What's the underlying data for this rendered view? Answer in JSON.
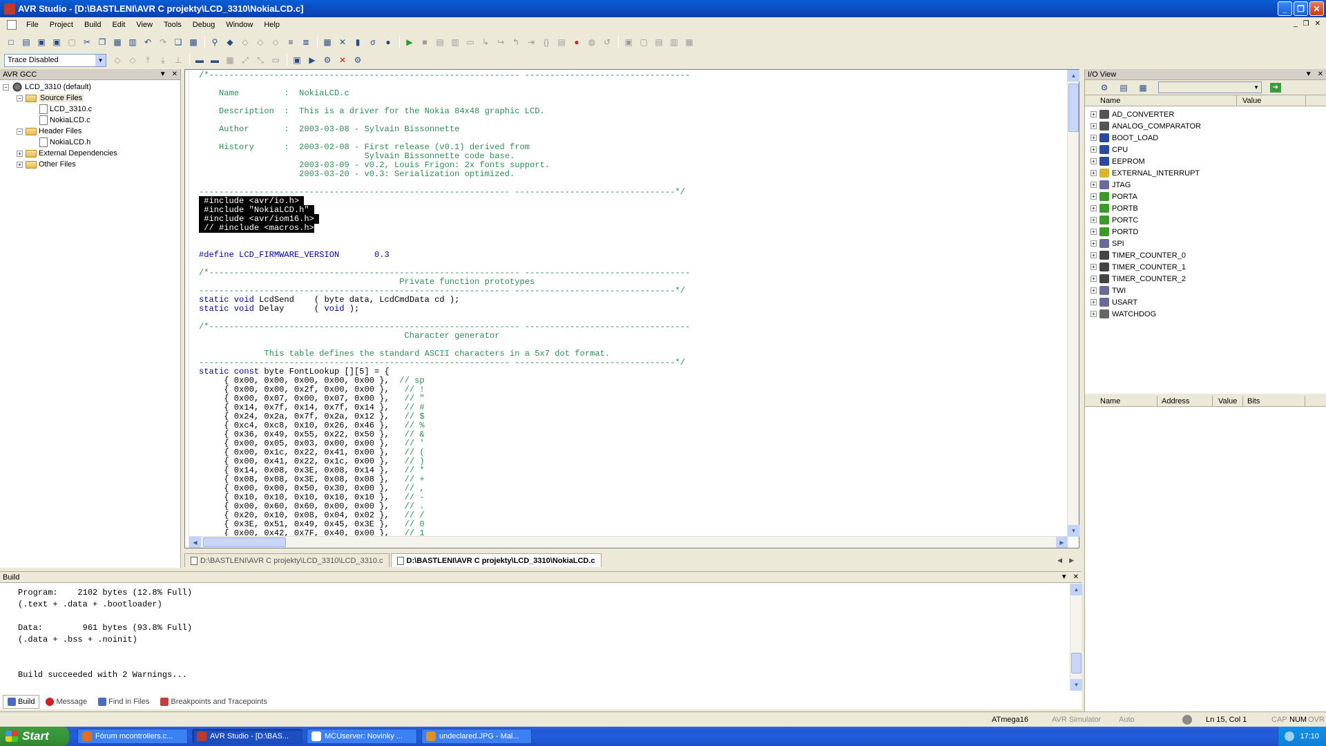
{
  "window": {
    "title": "AVR Studio - [D:\\BASTLENI\\AVR C projekty\\LCD_3310\\NokiaLCD.c]",
    "min": "_",
    "max": "❐",
    "close": "✕"
  },
  "menu": {
    "items": [
      "File",
      "Project",
      "Build",
      "Edit",
      "View",
      "Tools",
      "Debug",
      "Window",
      "Help"
    ],
    "mdi": [
      "_",
      "❐",
      "✕"
    ]
  },
  "toolbar2": {
    "trace_select": "Trace Disabled"
  },
  "left_panel": {
    "title": "AVR GCC",
    "tree": [
      {
        "label": "LCD_3310 (default)",
        "level": 0,
        "exp": "−",
        "icon": "proj"
      },
      {
        "label": "Source Files",
        "level": 1,
        "exp": "−",
        "icon": "folder"
      },
      {
        "label": "LCD_3310.c",
        "level": 2,
        "exp": "",
        "icon": "file"
      },
      {
        "label": "NokiaLCD.c",
        "level": 2,
        "exp": "",
        "icon": "file"
      },
      {
        "label": "Header Files",
        "level": 1,
        "exp": "−",
        "icon": "folder"
      },
      {
        "label": "NokiaLCD.h",
        "level": 2,
        "exp": "",
        "icon": "file"
      },
      {
        "label": "External Dependencies",
        "level": 1,
        "exp": "+",
        "icon": "folder"
      },
      {
        "label": "Other Files",
        "level": 1,
        "exp": "+",
        "icon": "folder"
      }
    ]
  },
  "editor": {
    "lines": [
      {
        "t": "c",
        "s": "/*-------------------------------------------------------------- ---------------------------------"
      },
      {
        "t": "c",
        "s": ""
      },
      {
        "t": "c",
        "s": "    Name         :  NokiaLCD.c"
      },
      {
        "t": "c",
        "s": ""
      },
      {
        "t": "c",
        "s": "    Description  :  This is a driver for the Nokia 84x48 graphic LCD."
      },
      {
        "t": "c",
        "s": ""
      },
      {
        "t": "c",
        "s": "    Author       :  2003-03-08 - Sylvain Bissonnette"
      },
      {
        "t": "c",
        "s": ""
      },
      {
        "t": "c",
        "s": "    History      :  2003-02-08 - First release (v0.1) derived from"
      },
      {
        "t": "c",
        "s": "                                 Sylvain Bissonnette code base."
      },
      {
        "t": "c",
        "s": "                    2003-03-09 - v0.2, Louis Frigon: 2x fonts support."
      },
      {
        "t": "c",
        "s": "                    2003-03-20 - v0.3: Serialization optimized."
      },
      {
        "t": "c",
        "s": ""
      },
      {
        "t": "c",
        "s": "-------------------------------------------------------------- --------------------------------*/"
      },
      {
        "t": "sel",
        "s": " #include <avr/io.h> "
      },
      {
        "t": "sel",
        "s": " #include \"NokiaLCD.h\" "
      },
      {
        "t": "sel",
        "s": " #include <avr/iom16.h> "
      },
      {
        "t": "sel",
        "s": " // #include <macros.h>"
      },
      {
        "t": "p",
        "s": ""
      },
      {
        "t": "p",
        "s": ""
      },
      {
        "t": "def",
        "s": "#define LCD_FIRMWARE_VERSION       0.3"
      },
      {
        "t": "p",
        "s": ""
      },
      {
        "t": "c",
        "s": "/*-------------------------------------------------------------- ---------------------------------"
      },
      {
        "t": "c",
        "s": "                                        Private function prototypes"
      },
      {
        "t": "c",
        "s": "-------------------------------------------------------------- --------------------------------*/"
      },
      {
        "t": "kw",
        "k": "static void",
        "s": " LcdSend    ( byte data, LcdCmdData cd );"
      },
      {
        "t": "kw",
        "k": "static void",
        "s": " Delay      ( ",
        "k2": "void",
        "s2": " );"
      },
      {
        "t": "p",
        "s": ""
      },
      {
        "t": "c",
        "s": "/*-------------------------------------------------------------- ---------------------------------"
      },
      {
        "t": "c",
        "s": "                                         Character generator"
      },
      {
        "t": "c",
        "s": ""
      },
      {
        "t": "c",
        "s": "             This table defines the standard ASCII characters in a 5x7 dot format."
      },
      {
        "t": "c",
        "s": "-------------------------------------------------------------- --------------------------------*/"
      },
      {
        "t": "kw",
        "k": "static const",
        "s": " byte FontLookup [][5] = {"
      },
      {
        "t": "row",
        "s": "     { 0x00, 0x00, 0x00, 0x00, 0x00 },",
        "c": "  // sp"
      },
      {
        "t": "row",
        "s": "     { 0x00, 0x00, 0x2f, 0x00, 0x00 },",
        "c": "   // !"
      },
      {
        "t": "row",
        "s": "     { 0x00, 0x07, 0x00, 0x07, 0x00 },",
        "c": "   // \""
      },
      {
        "t": "row",
        "s": "     { 0x14, 0x7f, 0x14, 0x7f, 0x14 },",
        "c": "   // #"
      },
      {
        "t": "row",
        "s": "     { 0x24, 0x2a, 0x7f, 0x2a, 0x12 },",
        "c": "   // $"
      },
      {
        "t": "row",
        "s": "     { 0xc4, 0xc8, 0x10, 0x26, 0x46 },",
        "c": "   // %"
      },
      {
        "t": "row",
        "s": "     { 0x36, 0x49, 0x55, 0x22, 0x50 },",
        "c": "   // &"
      },
      {
        "t": "row",
        "s": "     { 0x00, 0x05, 0x03, 0x00, 0x00 },",
        "c": "   // '"
      },
      {
        "t": "row",
        "s": "     { 0x00, 0x1c, 0x22, 0x41, 0x00 },",
        "c": "   // ("
      },
      {
        "t": "row",
        "s": "     { 0x00, 0x41, 0x22, 0x1c, 0x00 },",
        "c": "   // )"
      },
      {
        "t": "row",
        "s": "     { 0x14, 0x08, 0x3E, 0x08, 0x14 },",
        "c": "   // *"
      },
      {
        "t": "row",
        "s": "     { 0x08, 0x08, 0x3E, 0x08, 0x08 },",
        "c": "   // +"
      },
      {
        "t": "row",
        "s": "     { 0x00, 0x00, 0x50, 0x30, 0x00 },",
        "c": "   // ,"
      },
      {
        "t": "row",
        "s": "     { 0x10, 0x10, 0x10, 0x10, 0x10 },",
        "c": "   // -"
      },
      {
        "t": "row",
        "s": "     { 0x00, 0x60, 0x60, 0x00, 0x00 },",
        "c": "   // ."
      },
      {
        "t": "row",
        "s": "     { 0x20, 0x10, 0x08, 0x04, 0x02 },",
        "c": "   // /"
      },
      {
        "t": "row",
        "s": "     { 0x3E, 0x51, 0x49, 0x45, 0x3E },",
        "c": "   // 0"
      },
      {
        "t": "row",
        "s": "     { 0x00, 0x42, 0x7F, 0x40, 0x00 },",
        "c": "   // 1"
      }
    ]
  },
  "doc_tabs": [
    {
      "label": "D:\\BASTLENI\\AVR C projekty\\LCD_3310\\LCD_3310.c",
      "active": false
    },
    {
      "label": "D:\\BASTLENI\\AVR C projekty\\LCD_3310\\NokiaLCD.c",
      "active": true
    }
  ],
  "io_view": {
    "title": "I/O View",
    "columns": [
      "Name",
      "Value"
    ],
    "items": [
      {
        "label": "AD_CONVERTER",
        "color": "#555555"
      },
      {
        "label": "ANALOG_COMPARATOR",
        "color": "#555555"
      },
      {
        "label": "BOOT_LOAD",
        "color": "#2a4aa0"
      },
      {
        "label": "CPU",
        "color": "#2a4aa0"
      },
      {
        "label": "EEPROM",
        "color": "#2a4aa0"
      },
      {
        "label": "EXTERNAL_INTERRUPT",
        "color": "#d8b52c"
      },
      {
        "label": "JTAG",
        "color": "#6b6b9a"
      },
      {
        "label": "PORTA",
        "color": "#3b9a2a"
      },
      {
        "label": "PORTB",
        "color": "#3b9a2a"
      },
      {
        "label": "PORTC",
        "color": "#3b9a2a"
      },
      {
        "label": "PORTD",
        "color": "#3b9a2a"
      },
      {
        "label": "SPI",
        "color": "#6b6b9a"
      },
      {
        "label": "TIMER_COUNTER_0",
        "color": "#444444"
      },
      {
        "label": "TIMER_COUNTER_1",
        "color": "#444444"
      },
      {
        "label": "TIMER_COUNTER_2",
        "color": "#444444"
      },
      {
        "label": "TWI",
        "color": "#6b6b9a"
      },
      {
        "label": "USART",
        "color": "#6b6b9a"
      },
      {
        "label": "WATCHDOG",
        "color": "#666666"
      }
    ],
    "bottom_columns": [
      "Name",
      "Address",
      "Value",
      "Bits"
    ]
  },
  "build": {
    "title": "Build",
    "lines": [
      "Program:    2102 bytes (12.8% Full)",
      "(.text + .data + .bootloader)",
      "",
      "Data:        961 bytes (93.8% Full)",
      "(.data + .bss + .noinit)",
      "",
      "",
      "Build succeeded with 2 Warnings..."
    ],
    "tabs": [
      {
        "label": "Build",
        "active": true,
        "color": "#4a6bbf"
      },
      {
        "label": "Message",
        "active": false,
        "color": "#d02020"
      },
      {
        "label": "Find in Files",
        "active": false,
        "color": "#4a6bbf"
      },
      {
        "label": "Breakpoints and Tracepoints",
        "active": false,
        "color": "#c04040"
      }
    ]
  },
  "status": {
    "device": "ATmega16",
    "platform": "AVR Simulator",
    "mode": "Auto",
    "position": "Ln 15, Col 1",
    "cap": "CAP",
    "num": "NUM",
    "ovr": "OVR"
  },
  "taskbar": {
    "start": "Start",
    "tasks": [
      {
        "label": "Fórum mcontrollers.c...",
        "color": "#e07020",
        "active": false
      },
      {
        "label": "AVR Studio - [D:\\BAS...",
        "color": "#c0392b",
        "active": true
      },
      {
        "label": "MCUserver: Novinky ...",
        "color": "#ffffff",
        "active": false
      },
      {
        "label": "undeclared.JPG - Mal...",
        "color": "#d89030",
        "active": false
      }
    ],
    "clock": "17:10"
  }
}
